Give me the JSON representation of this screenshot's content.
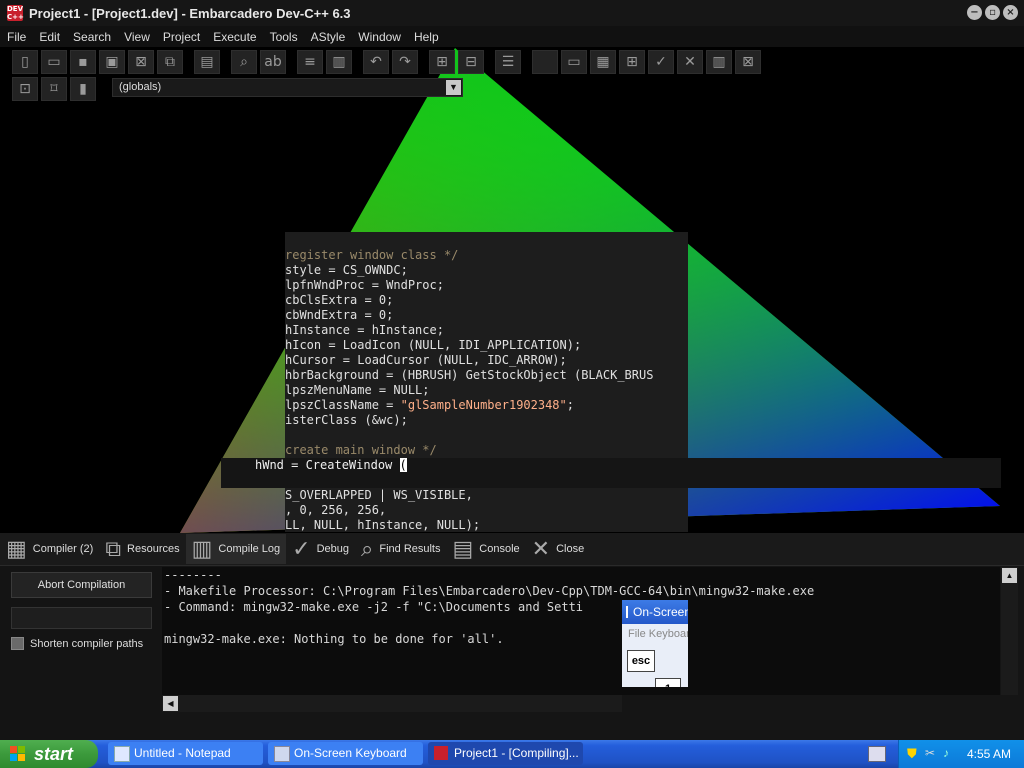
{
  "window": {
    "title": "Project1 - [Project1.dev] - Embarcadero Dev-C++ 6.3",
    "app_icon": "DEV C++",
    "buttons": [
      "minimize",
      "restore",
      "close"
    ]
  },
  "menu": [
    "File",
    "Edit",
    "Search",
    "View",
    "Project",
    "Execute",
    "Tools",
    "AStyle",
    "Window",
    "Help"
  ],
  "toolbar": {
    "row1_icons": [
      "new-file-icon",
      "open-icon",
      "save-icon",
      "save-all-icon",
      "close-file-icon",
      "close-all-icon",
      "print-icon",
      "find-icon",
      "replace-icon",
      "indent-icon",
      "unindent-icon",
      "undo-icon",
      "redo-icon",
      "add-to-project-icon",
      "remove-from-project-icon",
      "project-options-icon",
      "compile-icon",
      "run-icon",
      "compile-run-icon",
      "rebuild-icon",
      "check-syntax-icon",
      "stop-icon",
      "profile-icon",
      "delete-profile-icon"
    ],
    "row2_icons": [
      "goto-icon",
      "bookmark-icon",
      "bookmark-list-icon"
    ],
    "scope_select": "(globals)"
  },
  "editor": {
    "lines": [
      {
        "t": "register window class */",
        "c": "comment"
      },
      {
        "t": "style = CS_OWNDC;"
      },
      {
        "t": "lpfnWndProc = WndProc;"
      },
      {
        "t": "cbClsExtra = 0;"
      },
      {
        "t": "cbWndExtra = 0;"
      },
      {
        "t": "hInstance = hInstance;"
      },
      {
        "t": "hIcon = LoadIcon (NULL, IDI_APPLICATION);"
      },
      {
        "t": "hCursor = LoadCursor (NULL, IDC_ARROW);"
      },
      {
        "t": "hbrBackground = (HBRUSH) GetStockObject (BLACK_BRUS"
      },
      {
        "t": "lpszMenuName = NULL;"
      },
      {
        "t": "lpszClassName = \"glSampleNumber1902348\";",
        "s": "\"glSampleNumber1902348\""
      },
      {
        "t": "isterClass (&wc);"
      },
      {
        "t": ""
      },
      {
        "t": "create main window */",
        "c": "comment"
      }
    ],
    "current_line_prefix": "hWnd = CreateWindow ",
    "current_line_cursor": "(",
    "next_lines": [
      {
        "t": "\"\", \"\","
      },
      {
        "t": "S_OVERLAPPED | WS_VISIBLE,"
      },
      {
        "t": ", 0, 256, 256,"
      },
      {
        "t": "LL, NULL, hInstance, NULL);"
      }
    ]
  },
  "bottom_tabs": [
    {
      "label": "Compiler (2)",
      "icon": "grid-icon"
    },
    {
      "label": "Resources",
      "icon": "resources-icon"
    },
    {
      "label": "Compile Log",
      "icon": "bar-chart-icon",
      "active": true
    },
    {
      "label": "Debug",
      "icon": "check-icon"
    },
    {
      "label": "Find Results",
      "icon": "find-results-icon"
    },
    {
      "label": "Console",
      "icon": "console-icon"
    },
    {
      "label": "Close",
      "icon": "close-icon"
    }
  ],
  "compile": {
    "abort_label": "Abort Compilation",
    "shorten_label": "Shorten compiler paths",
    "log": [
      "--------",
      "- Makefile Processor: C:\\Program Files\\Embarcadero\\Dev-Cpp\\TDM-GCC-64\\bin\\mingw32-make.exe",
      "- Command: mingw32-make.exe -j2 -f \"C:\\Documents and Setti",
      "",
      "mingw32-make.exe: Nothing to be done for 'all'."
    ]
  },
  "osk": {
    "title": "On-Screen Keyboard",
    "menu": "File  Keyboard",
    "key_esc": "esc",
    "key_1": "1"
  },
  "taskbar": {
    "start": "start",
    "tasks": [
      {
        "label": "Untitled - Notepad",
        "icon": "notepad-icon"
      },
      {
        "label": "On-Screen Keyboard",
        "icon": "keyboard-icon"
      },
      {
        "label": "Project1 - [Compiling]...",
        "icon": "devcpp-icon",
        "active": true
      }
    ],
    "clock": "4:55 AM"
  }
}
